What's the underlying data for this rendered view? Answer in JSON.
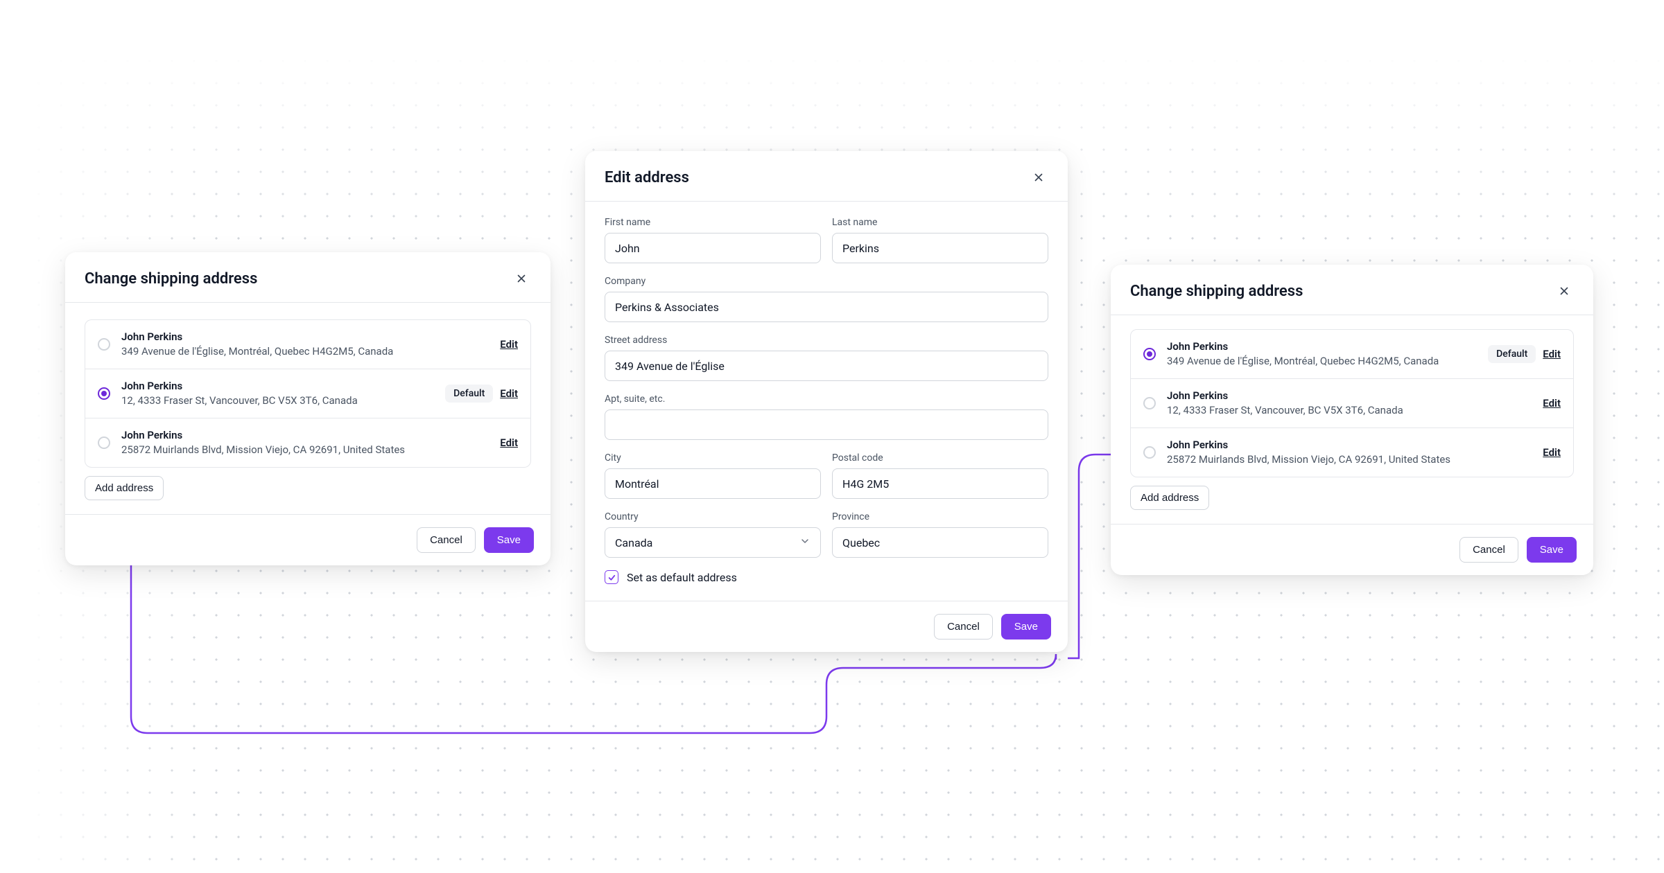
{
  "colors": {
    "accent": "#7c3aed"
  },
  "left_modal": {
    "title": "Change shipping address",
    "addresses": [
      {
        "name": "John Perkins",
        "line": "349 Avenue de l'Église, Montréal, Quebec H4G2M5, Canada",
        "selected": false,
        "is_default": false
      },
      {
        "name": "John Perkins",
        "line": "12, 4333 Fraser St, Vancouver, BC V5X 3T6, Canada",
        "selected": true,
        "is_default": true
      },
      {
        "name": "John Perkins",
        "line": "25872 Muirlands Blvd, Mission Viejo, CA 92691, United States",
        "selected": false,
        "is_default": false
      }
    ],
    "default_label": "Default",
    "edit_label": "Edit",
    "add_label": "Add address",
    "cancel_label": "Cancel",
    "save_label": "Save"
  },
  "edit_modal": {
    "title": "Edit address",
    "labels": {
      "first_name": "First name",
      "last_name": "Last name",
      "company": "Company",
      "street": "Street address",
      "apt": "Apt, suite, etc.",
      "city": "City",
      "postal": "Postal code",
      "country": "Country",
      "province": "Province",
      "set_default": "Set as default address"
    },
    "values": {
      "first_name": "John",
      "last_name": "Perkins",
      "company": "Perkins & Associates",
      "street": "349 Avenue de l'Église",
      "apt": "",
      "city": "Montréal",
      "postal": "H4G 2M5",
      "country": "Canada",
      "province": "Quebec"
    },
    "set_default_checked": true,
    "cancel_label": "Cancel",
    "save_label": "Save"
  },
  "right_modal": {
    "title": "Change shipping address",
    "addresses": [
      {
        "name": "John Perkins",
        "line": "349 Avenue de l'Église, Montréal, Quebec H4G2M5, Canada",
        "selected": true,
        "is_default": true
      },
      {
        "name": "John Perkins",
        "line": "12, 4333 Fraser St, Vancouver, BC V5X 3T6, Canada",
        "selected": false,
        "is_default": false
      },
      {
        "name": "John Perkins",
        "line": "25872 Muirlands Blvd, Mission Viejo, CA 92691, United States",
        "selected": false,
        "is_default": false
      }
    ],
    "default_label": "Default",
    "edit_label": "Edit",
    "add_label": "Add address",
    "cancel_label": "Cancel",
    "save_label": "Save"
  }
}
